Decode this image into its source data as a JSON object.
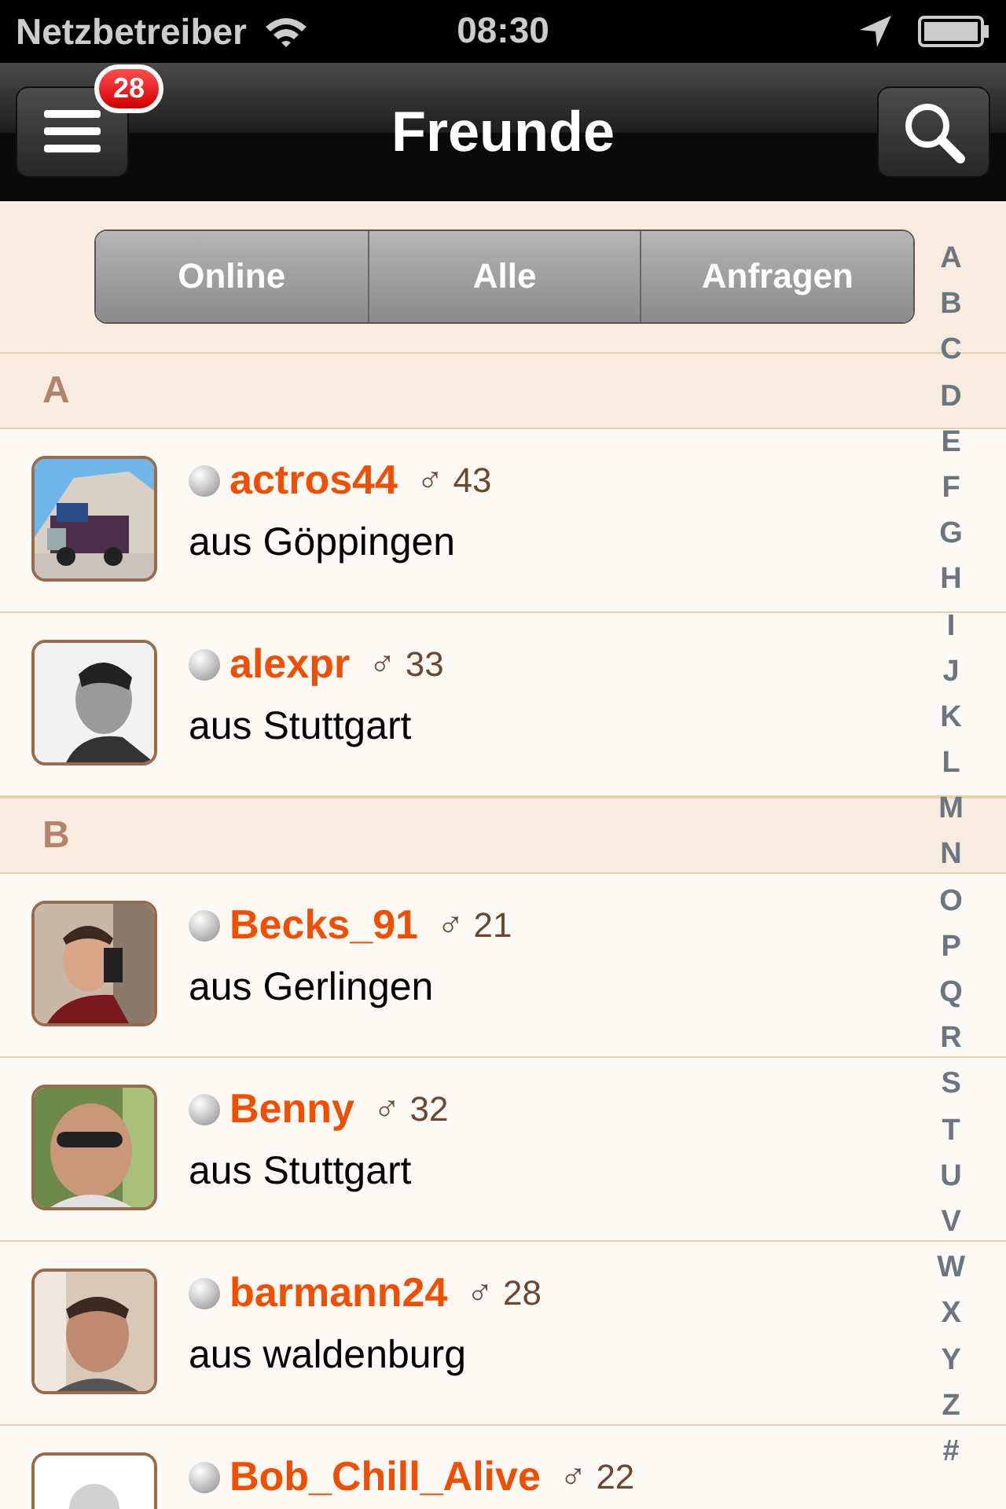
{
  "status_bar": {
    "carrier": "Netzbetreiber",
    "time": "08:30"
  },
  "nav": {
    "title": "Freunde",
    "badge": "28"
  },
  "segments": [
    {
      "label": "Online",
      "selected": false
    },
    {
      "label": "Alle",
      "selected": false
    },
    {
      "label": "Anfragen",
      "selected": false
    }
  ],
  "sections": [
    {
      "title": "A",
      "friends": [
        {
          "name": "actros44",
          "gender": "♂",
          "age": "43",
          "city": "aus Göppingen",
          "online": false
        },
        {
          "name": "alexpr",
          "gender": "♂",
          "age": "33",
          "city": "aus Stuttgart",
          "online": false
        }
      ]
    },
    {
      "title": "B",
      "friends": [
        {
          "name": "Becks_91",
          "gender": "♂",
          "age": "21",
          "city": "aus Gerlingen",
          "online": false
        },
        {
          "name": "Benny",
          "gender": "♂",
          "age": "32",
          "city": "aus Stuttgart",
          "online": false
        },
        {
          "name": "barmann24",
          "gender": "♂",
          "age": "28",
          "city": "aus waldenburg",
          "online": false
        },
        {
          "name": "Bob_Chill_Alive",
          "gender": "♂",
          "age": "22",
          "online": false
        }
      ]
    }
  ],
  "index": [
    "A",
    "B",
    "C",
    "D",
    "E",
    "F",
    "G",
    "H",
    "I",
    "J",
    "K",
    "L",
    "M",
    "N",
    "O",
    "P",
    "Q",
    "R",
    "S",
    "T",
    "U",
    "V",
    "W",
    "X",
    "Y",
    "Z",
    "#"
  ]
}
